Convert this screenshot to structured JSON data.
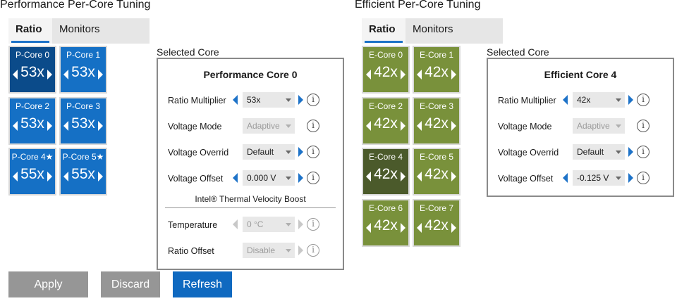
{
  "performance": {
    "title": "Performance Per-Core Tuning",
    "tabs": [
      "Ratio",
      "Monitors"
    ],
    "cores": [
      {
        "name": "P-Core 0",
        "value": "53x"
      },
      {
        "name": "P-Core 1",
        "value": "53x"
      },
      {
        "name": "P-Core 2",
        "value": "53x"
      },
      {
        "name": "P-Core 3",
        "value": "53x"
      },
      {
        "name": "P-Core 4★",
        "value": "55x"
      },
      {
        "name": "P-Core 5★",
        "value": "55x"
      }
    ],
    "selected_label": "Selected Core",
    "panel": {
      "title": "Performance Core 0",
      "rows": [
        {
          "label": "Ratio Multiplier",
          "value": "53x"
        },
        {
          "label": "Voltage Mode",
          "value": "Adaptive"
        },
        {
          "label": "Voltage Overrid",
          "value": "Default"
        },
        {
          "label": "Voltage Offset",
          "value": "0.000 V"
        }
      ],
      "section_title": "Intel® Thermal Velocity Boost",
      "tvb_rows": [
        {
          "label": "Temperature",
          "value": "0 °C"
        },
        {
          "label": "Ratio Offset",
          "value": "Disable"
        }
      ]
    }
  },
  "efficient": {
    "title": "Efficient Per-Core Tuning",
    "tabs": [
      "Ratio",
      "Monitors"
    ],
    "cores": [
      {
        "name": "E-Core 0",
        "value": "42x"
      },
      {
        "name": "E-Core 1",
        "value": "42x"
      },
      {
        "name": "E-Core 2",
        "value": "42x"
      },
      {
        "name": "E-Core 3",
        "value": "42x"
      },
      {
        "name": "E-Core 4",
        "value": "42x"
      },
      {
        "name": "E-Core 5",
        "value": "42x"
      },
      {
        "name": "E-Core 6",
        "value": "42x"
      },
      {
        "name": "E-Core 7",
        "value": "42x"
      }
    ],
    "selected_label": "Selected Core",
    "panel": {
      "title": "Efficient Core 4",
      "rows": [
        {
          "label": "Ratio Multiplier",
          "value": "42x"
        },
        {
          "label": "Voltage Mode",
          "value": "Adaptive"
        },
        {
          "label": "Voltage Overrid",
          "value": "Default"
        },
        {
          "label": "Voltage Offset",
          "value": "-0.125 V"
        }
      ]
    }
  },
  "buttons": {
    "apply": "Apply",
    "discard": "Discard",
    "refresh": "Refresh"
  },
  "icons": {
    "info": "i"
  },
  "colors": {
    "accent": "#1e73c8",
    "p_core_tile": "#1570c5",
    "p_core_selected": "#0b4b8a",
    "e_core_tile": "#79913b",
    "e_core_selected": "#4b5a2b",
    "gray_button": "#969696",
    "blue_button": "#0f69c0"
  }
}
